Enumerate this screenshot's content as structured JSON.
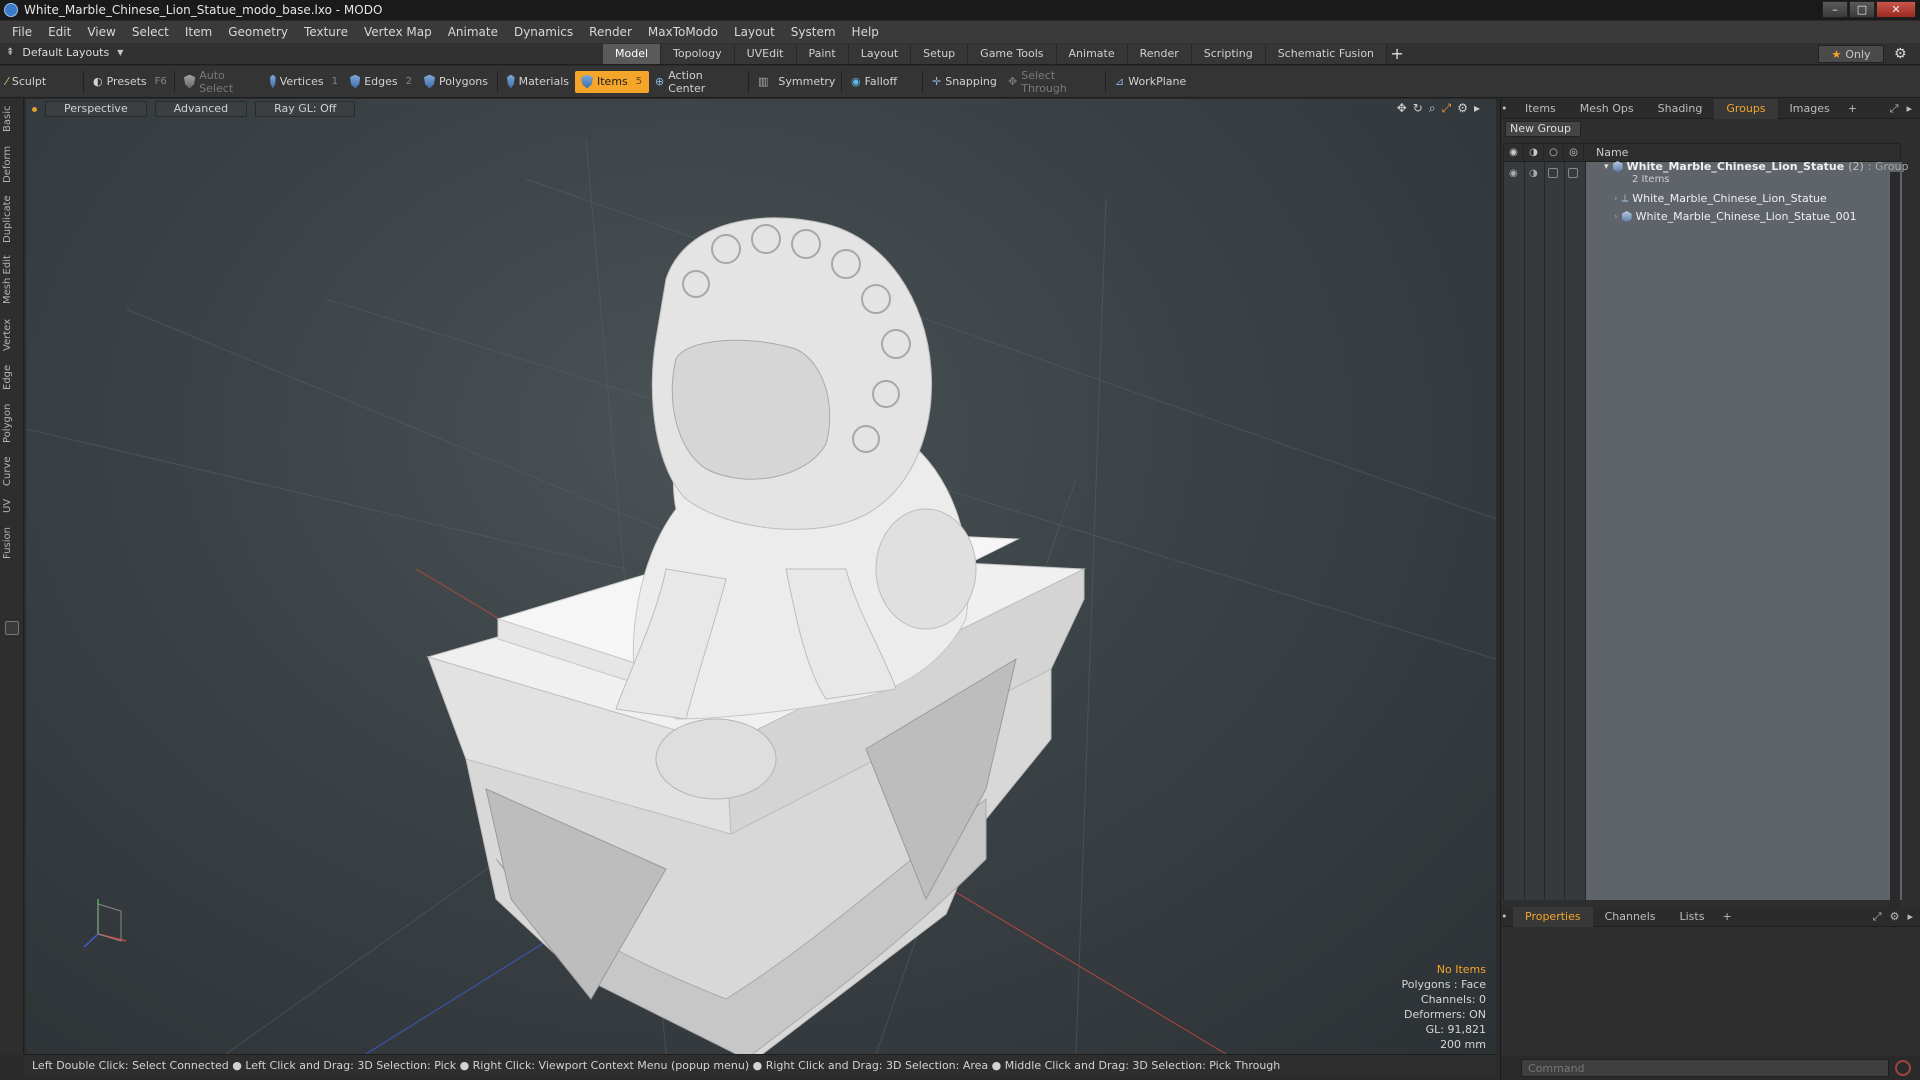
{
  "window": {
    "title": "White_Marble_Chinese_Lion_Statue_modo_base.lxo - MODO"
  },
  "menu": [
    "File",
    "Edit",
    "View",
    "Select",
    "Item",
    "Geometry",
    "Texture",
    "Vertex Map",
    "Animate",
    "Dynamics",
    "Render",
    "MaxToModo",
    "Layout",
    "System",
    "Help"
  ],
  "layouts": {
    "label": "Default Layouts"
  },
  "tabs": [
    {
      "label": "Model",
      "active": true
    },
    {
      "label": "Topology"
    },
    {
      "label": "UVEdit"
    },
    {
      "label": "Paint"
    },
    {
      "label": "Layout"
    },
    {
      "label": "Setup"
    },
    {
      "label": "Game Tools"
    },
    {
      "label": "Animate"
    },
    {
      "label": "Render"
    },
    {
      "label": "Scripting"
    },
    {
      "label": "Schematic Fusion"
    }
  ],
  "only_button": "Only",
  "toolbar": {
    "sculpt": "Sculpt",
    "presets": "Presets",
    "presets_hint": "F6",
    "auto_select": "Auto Select",
    "vertices": "Vertices",
    "vertices_hint": "1",
    "edges": "Edges",
    "edges_hint": "2",
    "polygons": "Polygons",
    "materials": "Materials",
    "items": "Items",
    "items_hint": "5",
    "action_center": "Action Center",
    "symmetry": "Symmetry",
    "falloff": "Falloff",
    "snapping": "Snapping",
    "select_through": "Select Through",
    "workplane": "WorkPlane"
  },
  "left_tabs": [
    "Basic",
    "Deform",
    "Duplicate",
    "Mesh Edit",
    "Vertex",
    "Edge",
    "Polygon",
    "Curve",
    "UV",
    "Fusion"
  ],
  "viewport": {
    "view": "Perspective",
    "shading": "Advanced",
    "raygl": "Ray GL: Off",
    "info": {
      "no_items": "No Items",
      "polygons": "Polygons : Face",
      "channels": "Channels: 0",
      "deformers": "Deformers: ON",
      "gl": "GL: 91,821",
      "scale": "200 mm"
    }
  },
  "status": "Left Double Click: Select Connected ● Left Click and Drag: 3D Selection: Pick ● Right Click: Viewport Context Menu (popup menu) ● Right Click and Drag: 3D Selection: Area ● Middle Click and Drag: 3D Selection: Pick Through",
  "panel_tabs": [
    "Items",
    "Mesh Ops",
    "Shading",
    "Groups",
    "Images"
  ],
  "panel_active_tab": "Groups",
  "groups": {
    "new_group": "New Group",
    "name_header": "Name",
    "group_name": "White_Marble_Chinese_Lion_Statue",
    "group_count": "(2)",
    "group_type": ": Group",
    "group_sub": "2 Items",
    "children": [
      "White_Marble_Chinese_Lion_Statue",
      "White_Marble_Chinese_Lion_Statue_001"
    ]
  },
  "bottom_tabs": [
    "Properties",
    "Channels",
    "Lists"
  ],
  "command": {
    "placeholder": "Command"
  },
  "colors": {
    "accent": "#f4a52a",
    "viewport_bg": "#3b4246",
    "panel": "#2e2e2e"
  }
}
